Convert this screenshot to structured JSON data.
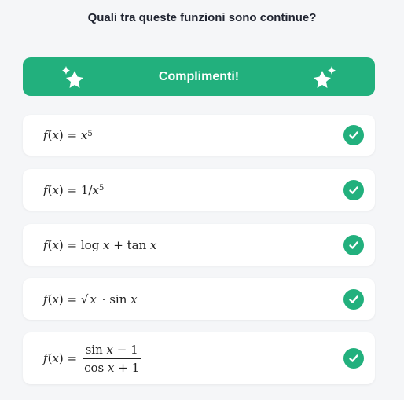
{
  "question": "Quali tra queste funzioni sono continue?",
  "banner": {
    "text": "Complimenti!"
  },
  "options": [
    {
      "id": 1,
      "status": "correct"
    },
    {
      "id": 2,
      "status": "correct"
    },
    {
      "id": 3,
      "status": "correct"
    },
    {
      "id": 4,
      "status": "correct"
    },
    {
      "id": 5,
      "status": "correct"
    }
  ],
  "colors": {
    "accent": "#22b07d",
    "background": "#f5f6f8",
    "card": "#ffffff"
  }
}
